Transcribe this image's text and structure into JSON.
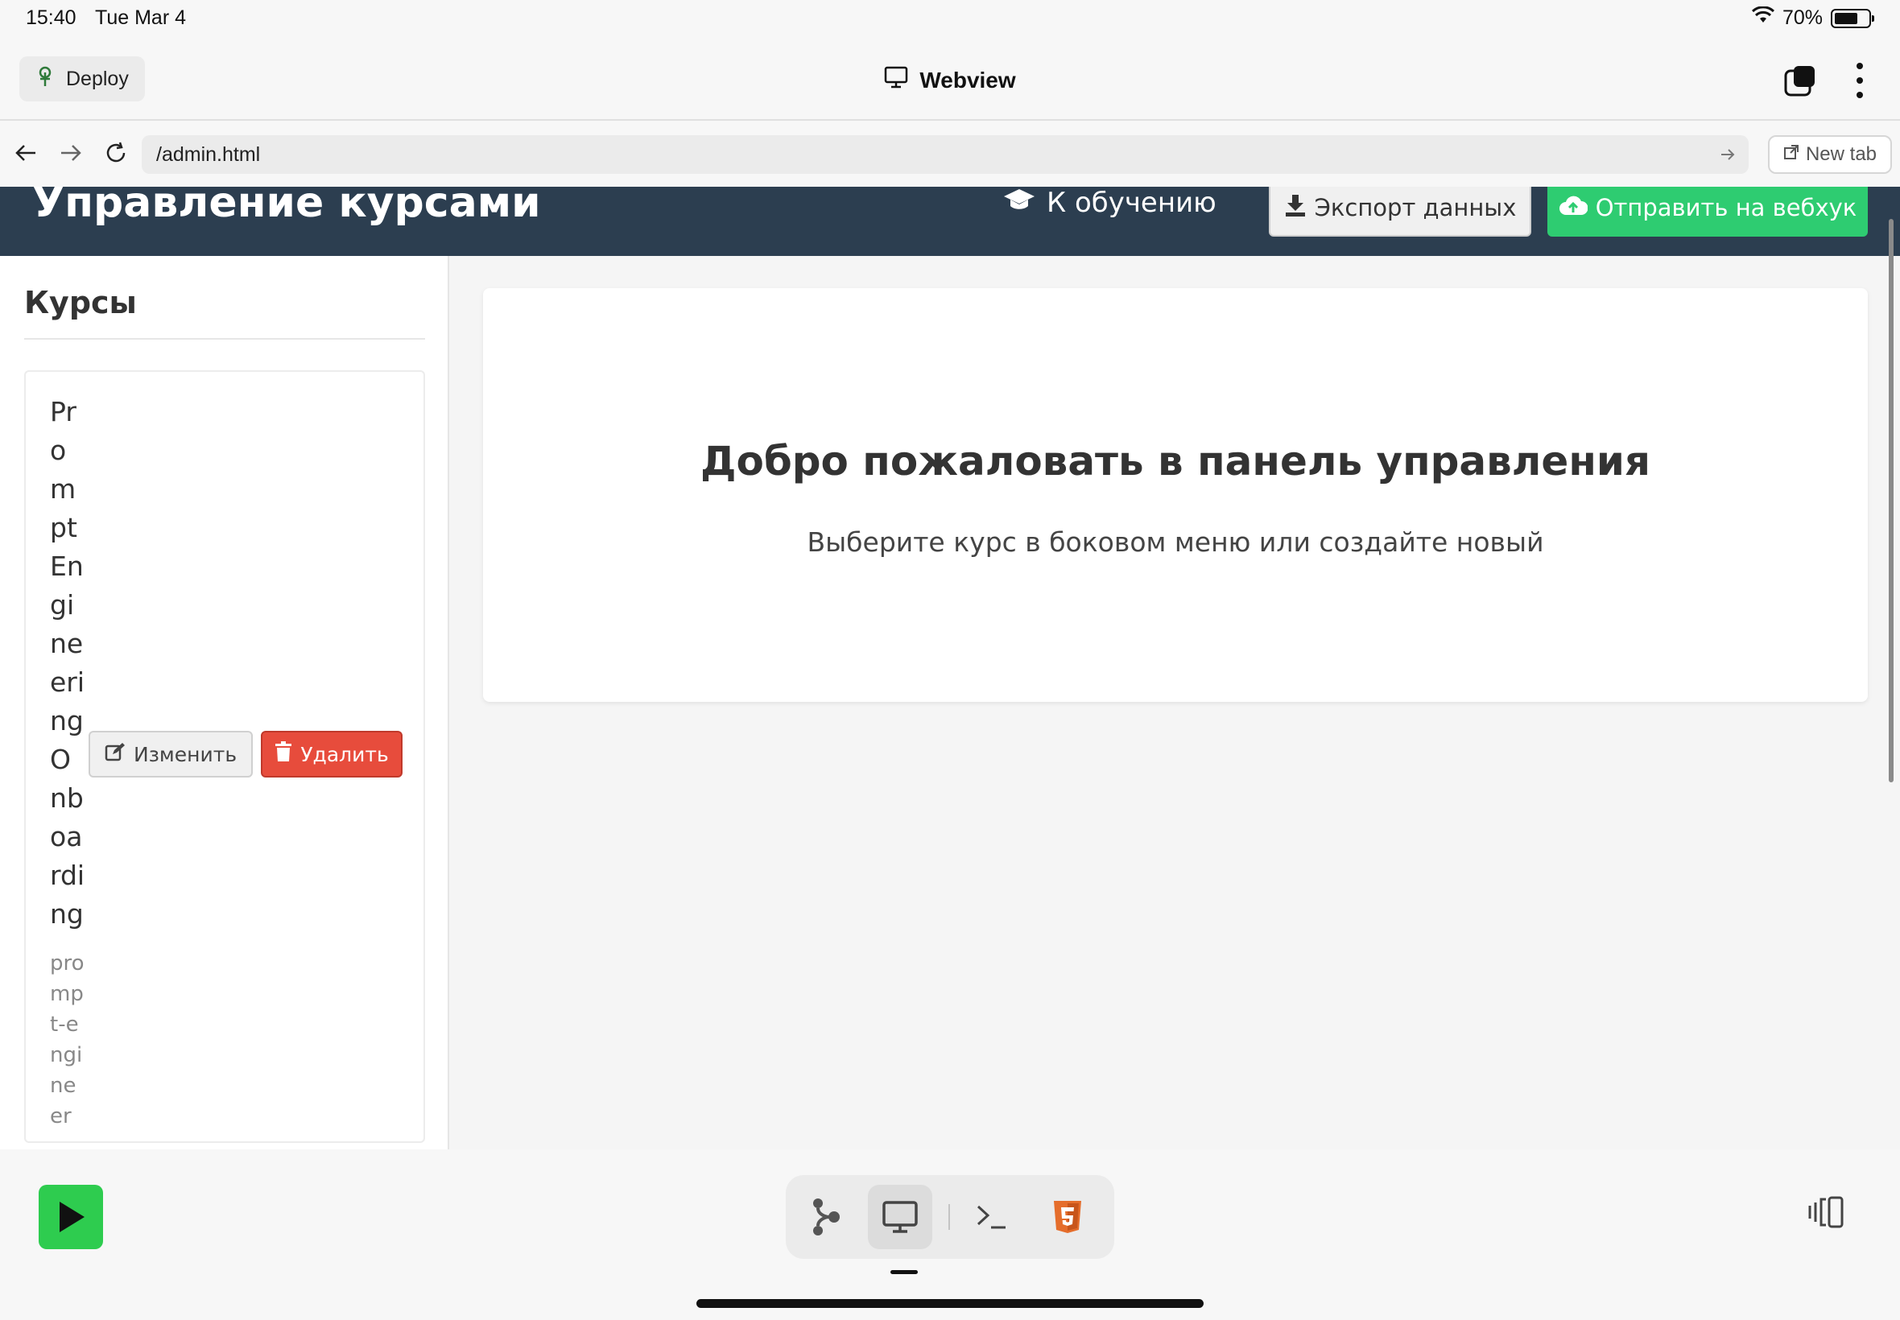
{
  "status_bar": {
    "time": "15:40",
    "date": "Tue Mar 4",
    "battery_text": "70%",
    "battery_level": 0.7
  },
  "app_bar": {
    "deploy_label": "Deploy",
    "title": "Webview"
  },
  "browser": {
    "url": "/admin.html",
    "new_tab_label": "New tab"
  },
  "site": {
    "title": "Управление курсами",
    "to_learning": "К обучению",
    "export_label": "Экспорт данных",
    "webhook_label": "Отправить на вебхук",
    "colors": {
      "header": "#2c3e50",
      "success": "#2ecc71",
      "danger": "#e74c3c"
    }
  },
  "sidebar": {
    "title": "Курсы",
    "courses": [
      {
        "name": "Prompt Engineering Onboarding",
        "slug": "prompt-engineer",
        "edit_label": "Изменить",
        "delete_label": "Удалить"
      }
    ]
  },
  "main": {
    "welcome_title": "Добро пожаловать в панель управления",
    "welcome_subtitle": "Выберите курс в боковом меню или создайте новый"
  },
  "bottom_bar": {
    "tools": [
      "flow-icon",
      "monitor-icon",
      "terminal-icon",
      "html5-icon"
    ],
    "active_tool": "monitor-icon"
  }
}
